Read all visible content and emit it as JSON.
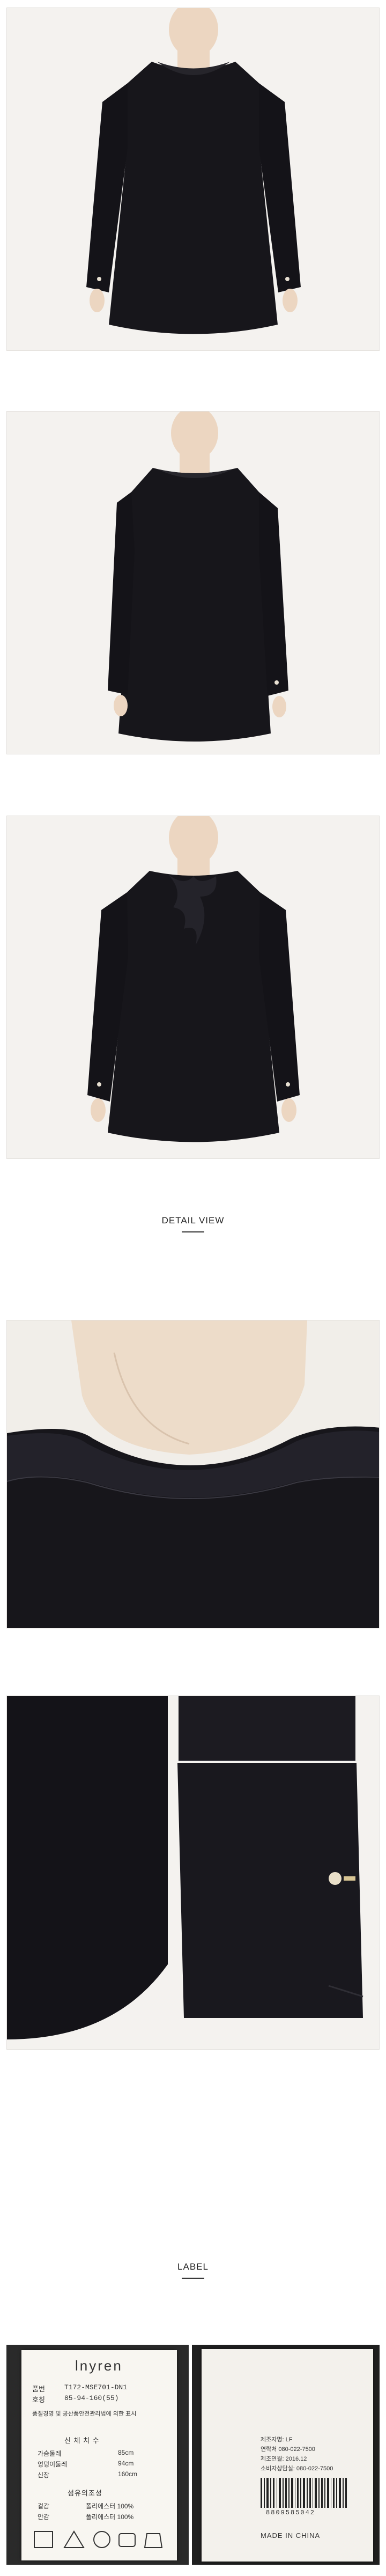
{
  "sections": {
    "detail_view": {
      "title": "DETAIL VIEW"
    },
    "label": {
      "title": "LABEL"
    }
  },
  "label_tag": {
    "brand": "lnyren",
    "rows": [
      {
        "key": "품번",
        "value": "T172-MSE701-DN1"
      },
      {
        "key": "호칭",
        "value": "85-94-160(55)"
      }
    ],
    "size_header": "신 체 치 수",
    "sizes": [
      {
        "key": "가슴둘레",
        "value": "85cm"
      },
      {
        "key": "엉덩이둘레",
        "value": "94cm"
      },
      {
        "key": "신장",
        "value": "160cm"
      }
    ],
    "fiber_header": "섬유의조성",
    "fibers": [
      {
        "key": "겉감",
        "value": "폴리에스터 100%"
      },
      {
        "key": "안감",
        "value": "폴리에스터 100%"
      }
    ],
    "care_note": "품질경영 및 공산품안전관리법에 의한 표시",
    "right_lines": [
      "제조자명: LF",
      "연락처 080-022-7500",
      "제조연월: 2016.12",
      "소비자상담실: 080-022-7500"
    ],
    "barcode_number": "8809585042",
    "made_in": "MADE IN CHINA"
  },
  "colors": {
    "dress": "#17161b",
    "background": "#f4f2ef",
    "skin": "#efd9c4"
  }
}
